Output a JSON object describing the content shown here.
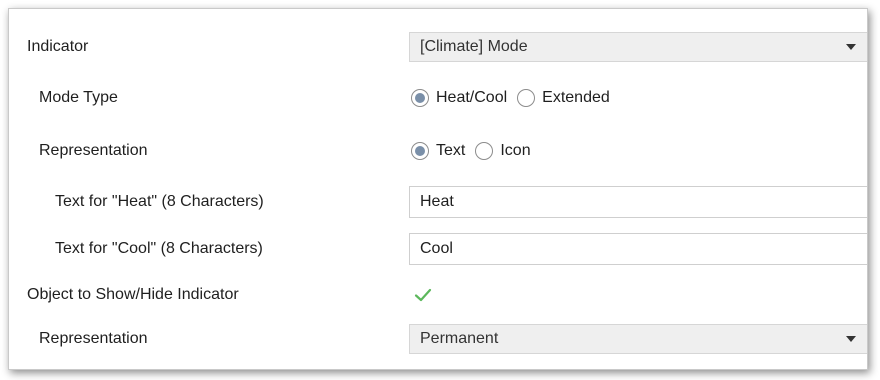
{
  "rows": {
    "indicator": {
      "label": "Indicator",
      "value": "[Climate] Mode"
    },
    "mode_type": {
      "label": "Mode Type",
      "options": [
        "Heat/Cool",
        "Extended"
      ],
      "selected": "Heat/Cool"
    },
    "representation_text": {
      "label": "Representation",
      "options": [
        "Text",
        "Icon"
      ],
      "selected": "Text"
    },
    "text_heat": {
      "label": "Text for \"Heat\" (8 Characters)",
      "value": "Heat"
    },
    "text_cool": {
      "label": "Text for \"Cool\" (8 Characters)",
      "value": "Cool"
    },
    "show_hide_object": {
      "label": "Object to Show/Hide Indicator",
      "checked": true
    },
    "representation_visibility": {
      "label": "Representation",
      "value": "Permanent"
    }
  },
  "icons": {
    "dropdown_arrow": "chevron-down-icon",
    "checkbox_check": "check-icon"
  },
  "colors": {
    "radio_selected": "#7a8fa8",
    "check_green": "#5cb85c",
    "dropdown_bg": "#efefef"
  }
}
